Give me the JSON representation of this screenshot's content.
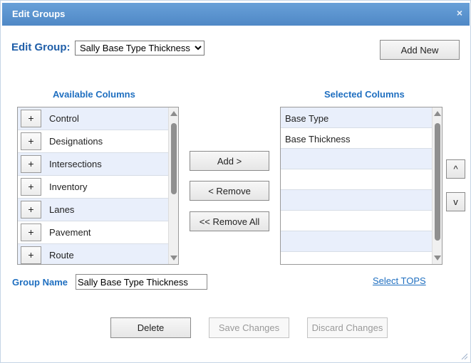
{
  "dialog": {
    "title": "Edit Groups",
    "close_symbol": "×"
  },
  "edit_group": {
    "label": "Edit Group:",
    "selected": "Sally Base Type Thickness",
    "add_new_label": "Add New"
  },
  "available": {
    "header": "Available Columns",
    "add_symbol": "+",
    "items": [
      "Control",
      "Designations",
      "Intersections",
      "Inventory",
      "Lanes",
      "Pavement",
      "Route"
    ]
  },
  "selected": {
    "header": "Selected Columns",
    "items": [
      "Base Type",
      "Base Thickness",
      "",
      "",
      "",
      "",
      ""
    ]
  },
  "transfer": {
    "add_label": "Add >",
    "remove_label": "< Remove",
    "remove_all_label": "<< Remove All"
  },
  "order": {
    "up_label": "^",
    "down_label": "v"
  },
  "group_name": {
    "label": "Group Name",
    "value": "Sally Base Type Thickness"
  },
  "select_tops_label": "Select TOPS",
  "footer": {
    "delete_label": "Delete",
    "save_label": "Save Changes",
    "discard_label": "Discard Changes"
  }
}
